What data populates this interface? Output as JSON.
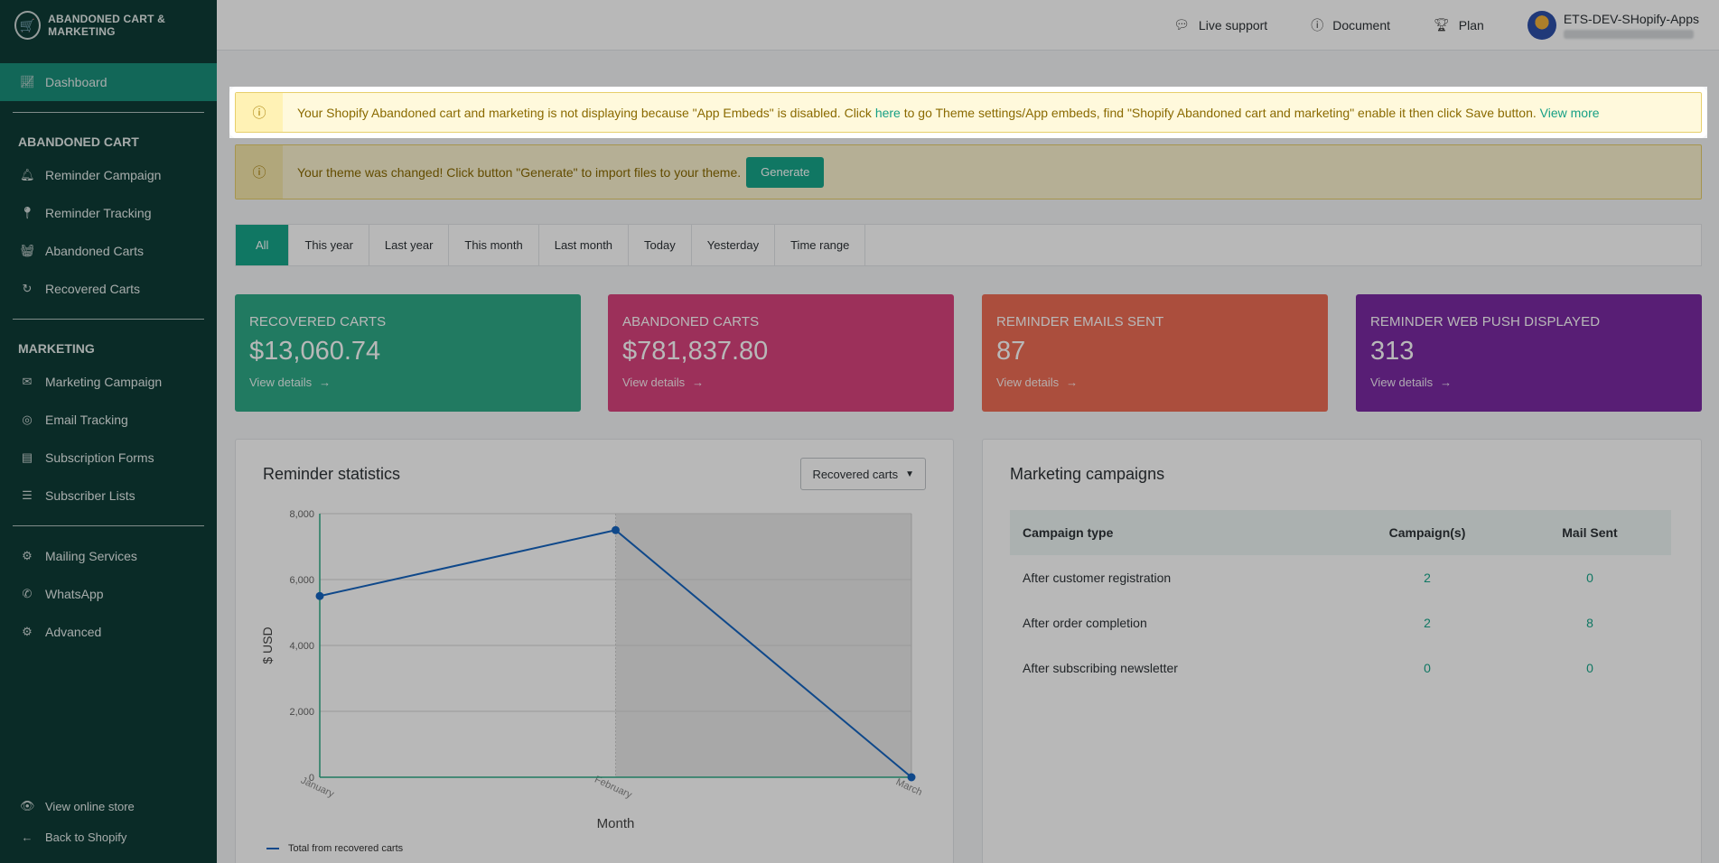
{
  "brand": {
    "title": "Abandoned cart & Marketing",
    "logo_icon": "cart-icon"
  },
  "sidebar": {
    "dashboard": "Dashboard",
    "abandoned_heading": "ABANDONED CART",
    "abandoned_items": [
      {
        "label": "Reminder Campaign",
        "icon": "bell-icon"
      },
      {
        "label": "Reminder Tracking",
        "icon": "map-pin-icon"
      },
      {
        "label": "Abandoned Carts",
        "icon": "basket-icon"
      },
      {
        "label": "Recovered Carts",
        "icon": "refresh-icon"
      }
    ],
    "marketing_heading": "MARKETING",
    "marketing_items": [
      {
        "label": "Marketing Campaign",
        "icon": "envelope-icon"
      },
      {
        "label": "Email Tracking",
        "icon": "target-icon"
      },
      {
        "label": "Subscription Forms",
        "icon": "form-icon"
      },
      {
        "label": "Subscriber Lists",
        "icon": "list-icon"
      }
    ],
    "settings_items": [
      {
        "label": "Mailing Services",
        "icon": "gear-icon"
      },
      {
        "label": "WhatsApp",
        "icon": "whatsapp-icon"
      },
      {
        "label": "Advanced",
        "icon": "gears-icon"
      }
    ],
    "bottom_items": [
      {
        "label": "View online store",
        "icon": "eye-icon"
      },
      {
        "label": "Back to Shopify",
        "icon": "arrow-left-icon"
      }
    ]
  },
  "topbar": {
    "live_support": "Live support",
    "document": "Document",
    "plan": "Plan",
    "user_name": "ETS-DEV-SHopify-Apps"
  },
  "alerts": {
    "embed_pre": "Your Shopify Abandoned cart and marketing is not displaying because \"App Embeds\" is disabled. Click ",
    "embed_link": "here",
    "embed_post": " to go Theme settings/App embeds, find \"Shopify Abandoned cart and marketing\" enable it then click Save button. ",
    "embed_more": "View more",
    "theme_text": "Your theme was changed! Click button \"Generate\" to import files to your theme.",
    "generate_label": "Generate"
  },
  "tabs": [
    "All",
    "This year",
    "Last year",
    "This month",
    "Last month",
    "Today",
    "Yesterday",
    "Time range"
  ],
  "cards": [
    {
      "title": "RECOVERED CARTS",
      "value": "$13,060.74",
      "link": "View details",
      "color": "#2eaa87"
    },
    {
      "title": "ABANDONED CARTS",
      "value": "$781,837.80",
      "link": "View details",
      "color": "#d9437d"
    },
    {
      "title": "REMINDER EMAILS SENT",
      "value": "87",
      "link": "View details",
      "color": "#ee6c55"
    },
    {
      "title": "REMINDER WEB PUSH DISPLAYED",
      "value": "313",
      "link": "View details",
      "color": "#7a2aa3"
    }
  ],
  "reminder": {
    "title": "Reminder statistics",
    "select_value": "Recovered carts"
  },
  "chart_data": {
    "type": "line",
    "categories": [
      "January",
      "February",
      "March"
    ],
    "series": [
      {
        "name": "Total from recovered carts",
        "values": [
          5500,
          7500,
          0
        ],
        "color": "#1565c0"
      }
    ],
    "xlabel": "Month",
    "ylabel": "$ USD",
    "ylim": [
      0,
      8000
    ],
    "yticks": [
      "0",
      "2,000",
      "4,000",
      "6,000",
      "8,000"
    ],
    "yticks_values": [
      0,
      2000,
      4000,
      6000,
      8000
    ],
    "grid": true,
    "legend": "bottom-left"
  },
  "campaigns": {
    "title": "Marketing campaigns",
    "headers": [
      "Campaign type",
      "Campaign(s)",
      "Mail Sent"
    ],
    "rows": [
      [
        "After customer registration",
        "2",
        "0"
      ],
      [
        "After order completion",
        "2",
        "8"
      ],
      [
        "After subscribing newsletter",
        "0",
        "0"
      ]
    ]
  }
}
